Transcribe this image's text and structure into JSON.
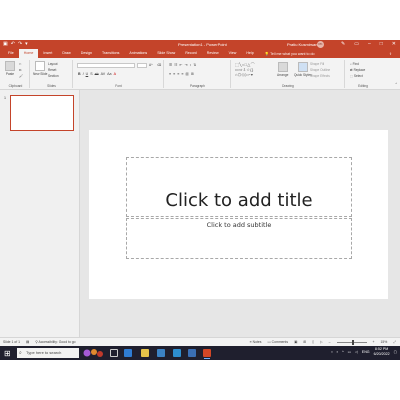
{
  "titlebar": {
    "document_title": "Presentation1  -  PowerPoint",
    "user_name": "Pratiu Kusmirsan",
    "avatar_initials": "PK",
    "accent_color": "#c4442a"
  },
  "tabs": [
    "File",
    "Home",
    "Insert",
    "Draw",
    "Design",
    "Transitions",
    "Animations",
    "Slide Show",
    "Record",
    "Review",
    "View",
    "Help"
  ],
  "active_tab": "Home",
  "tell_me": "Tell me what you want to do",
  "ribbon": {
    "clipboard": {
      "label": "Clipboard",
      "paste": "Paste"
    },
    "slides": {
      "label": "Slides",
      "new_slide": "New Slide",
      "layout": "Layout",
      "reset": "Reset",
      "section": "Section"
    },
    "font": {
      "label": "Font",
      "format_buttons": [
        "B",
        "I",
        "U",
        "S",
        "ab",
        "AV",
        "Aa",
        "A"
      ]
    },
    "paragraph": {
      "label": "Paragraph"
    },
    "drawing": {
      "label": "Drawing",
      "arrange": "Arrange",
      "quick_styles": "Quick Styles",
      "shape_fill": "Shape Fill",
      "shape_outline": "Shape Outline",
      "shape_effects": "Shape Effects"
    },
    "editing": {
      "label": "Editing",
      "find": "Find",
      "replace": "Replace",
      "select": "Select"
    }
  },
  "thumbnail": {
    "number": "1"
  },
  "slide": {
    "title_placeholder": "Click to add title",
    "subtitle_placeholder": "Click to add subtitle"
  },
  "statusbar": {
    "slide_info": "Slide 1 of 1",
    "accessibility": "Accessibility: Good to go",
    "notes": "Notes",
    "comments": "Comments",
    "zoom": "15%",
    "zoom_level": 0.5
  },
  "taskbar": {
    "search_placeholder": "Type here to search",
    "time": "8:52 PM",
    "date": "6/20/2022"
  }
}
